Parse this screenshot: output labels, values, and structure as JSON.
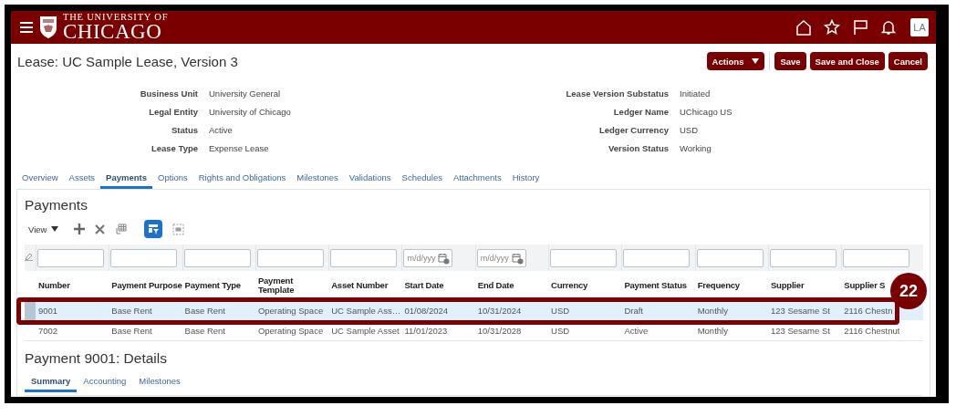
{
  "header": {
    "logo": {
      "line_1": "THE UNIVERSITY OF",
      "line_2": "CHICAGO"
    },
    "avatar": "LA"
  },
  "page_title": "Lease: UC Sample Lease, Version 3",
  "actions": [
    {
      "label": "Actions",
      "kind": "menu"
    },
    {
      "label": "Save",
      "kind": "button"
    },
    {
      "label": "Save and Close",
      "kind": "button"
    },
    {
      "label": "Cancel",
      "kind": "button"
    }
  ],
  "fields_left": [
    {
      "label": "Business Unit",
      "value": "University General"
    },
    {
      "label": "Legal Entity",
      "value": "University of Chicago"
    },
    {
      "label": "Status",
      "value": "Active"
    },
    {
      "label": "Lease Type",
      "value": "Expense Lease"
    }
  ],
  "fields_right": [
    {
      "label": "Lease Version Substatus",
      "value": "Initiated"
    },
    {
      "label": "Ledger Name",
      "value": "UChicago US"
    },
    {
      "label": "Ledger Currency",
      "value": "USD"
    },
    {
      "label": "Version Status",
      "value": "Working"
    }
  ],
  "tabs": [
    {
      "label": "Overview",
      "selected": false
    },
    {
      "label": "Assets",
      "selected": false
    },
    {
      "label": "Payments",
      "selected": true
    },
    {
      "label": "Options",
      "selected": false
    },
    {
      "label": "Rights and Obligations",
      "selected": false
    },
    {
      "label": "Milestones",
      "selected": false
    },
    {
      "label": "Validations",
      "selected": false
    },
    {
      "label": "Schedules",
      "selected": false
    },
    {
      "label": "Attachments",
      "selected": false
    },
    {
      "label": "History",
      "selected": false
    }
  ],
  "payments": {
    "title": "Payments",
    "view_menu": "View",
    "query_by_example": true,
    "filters": [
      {
        "kind": "text"
      },
      {
        "kind": "text"
      },
      {
        "kind": "text"
      },
      {
        "kind": "text"
      },
      {
        "kind": "text"
      },
      {
        "kind": "date",
        "placeholder": "m/d/yyy"
      },
      {
        "kind": "date",
        "placeholder": "m/d/yyy"
      },
      {
        "kind": "text"
      },
      {
        "kind": "text"
      },
      {
        "kind": "text"
      },
      {
        "kind": "text"
      },
      {
        "kind": "text"
      }
    ],
    "columns": [
      "Number",
      "Payment Purpose",
      "Payment Type",
      "Payment Template",
      "Asset Number",
      "Start Date",
      "End Date",
      "Currency",
      "Payment Status",
      "Frequency",
      "Supplier",
      "Supplier S"
    ],
    "rows": [
      {
        "selected": true,
        "cells": [
          "9001",
          "Base Rent",
          "Base Rent",
          "Operating Space",
          "UC Sample Ass…",
          "01/08/2024",
          "10/31/2024",
          "USD",
          "Draft",
          "Monthly",
          "123 Sesame St",
          "2116 Chestn"
        ]
      },
      {
        "selected": false,
        "cells": [
          "7002",
          "Base Rent",
          "Base Rent",
          "Operating Space",
          "UC Sample Asset",
          "11/01/2023",
          "10/31/2028",
          "USD",
          "Active",
          "Monthly",
          "123 Sesame St",
          "2116 Chestnut"
        ]
      }
    ]
  },
  "details": {
    "title": "Payment 9001: Details",
    "tabs": [
      {
        "label": "Summary",
        "selected": true
      },
      {
        "label": "Accounting",
        "selected": false
      },
      {
        "label": "Milestones",
        "selected": false
      }
    ]
  },
  "annotation": {
    "badge": "22"
  }
}
